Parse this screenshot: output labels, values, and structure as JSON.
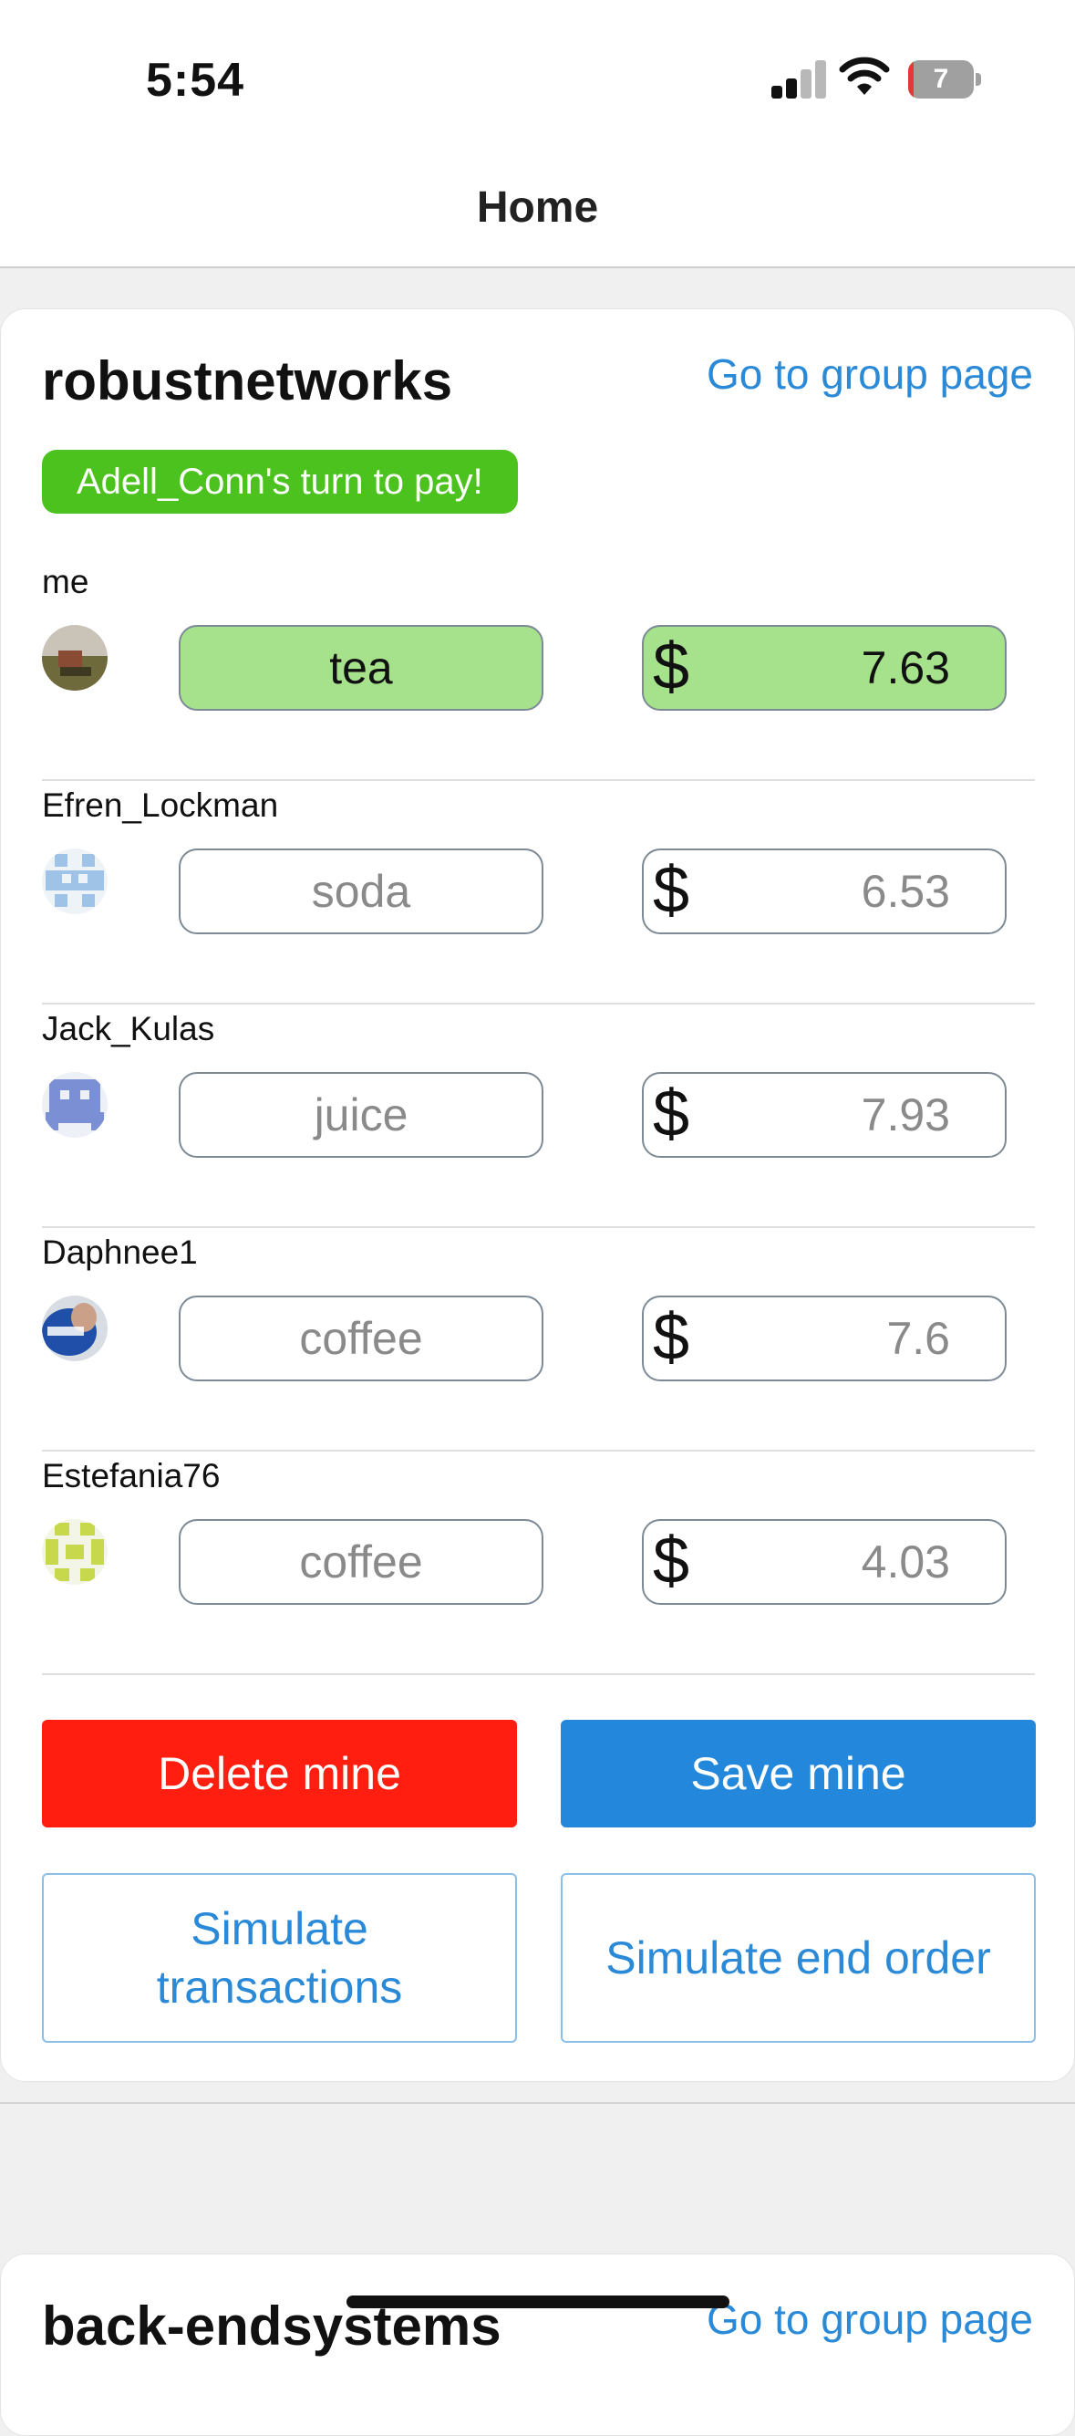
{
  "status_bar": {
    "time": "5:54",
    "battery_level": "7",
    "icons": [
      "signal-icon",
      "wifi-icon",
      "battery-icon"
    ]
  },
  "nav": {
    "title": "Home"
  },
  "group": {
    "name": "robustnetworks",
    "link_label": "Go to group page",
    "turn_badge": "Adell_Conn's turn to pay!",
    "currency_symbol": "$",
    "members": [
      {
        "name": "me",
        "item": "tea",
        "price": "7.63"
      },
      {
        "name": "Efren_Lockman",
        "item": "soda",
        "price": "6.53"
      },
      {
        "name": "Jack_Kulas",
        "item": "juice",
        "price": "7.93"
      },
      {
        "name": "Daphnee1",
        "item": "coffee",
        "price": "7.6"
      },
      {
        "name": "Estefania76",
        "item": "coffee",
        "price": "4.03"
      }
    ],
    "buttons": {
      "delete": "Delete mine",
      "save": "Save mine",
      "simulate_transactions": "Simulate transactions",
      "simulate_end_order": "Simulate end order"
    }
  },
  "next_group": {
    "name": "back-endsystems",
    "link_label": "Go to group page"
  },
  "colors": {
    "accent_blue": "#2388dc",
    "badge_green": "#4cc21f",
    "mine_highlight": "#a6e28c",
    "delete_red": "#ff1e10"
  }
}
